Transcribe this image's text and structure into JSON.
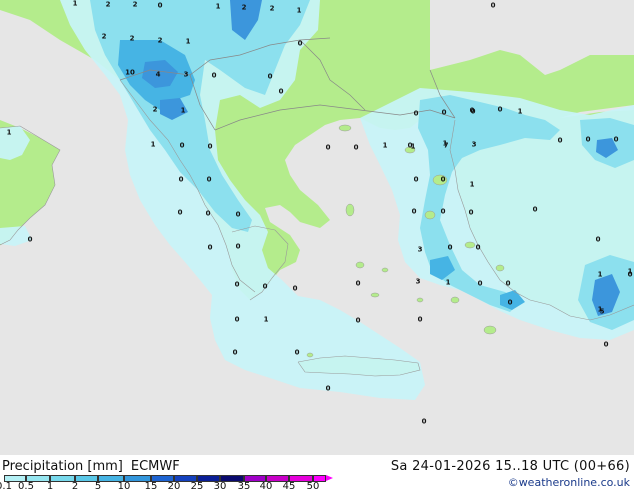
{
  "title": {
    "variable": "Precipitation [mm]",
    "model": "ECMWF",
    "valid_time": "Sa 24-01-2026 15..18 UTC (00+66)"
  },
  "credit": "©weatheronline.co.uk",
  "legend": {
    "ticks": [
      "0.1",
      "0.5",
      "1",
      "2",
      "5",
      "10",
      "15",
      "20",
      "25",
      "30",
      "35",
      "40",
      "45",
      "50"
    ],
    "colors": [
      "#b4f0f5",
      "#96e6f0",
      "#78d9ec",
      "#5ac8e8",
      "#46b4e4",
      "#3296dc",
      "#1e64d2",
      "#1441be",
      "#0a1e96",
      "#0a0a6e",
      "#a000c8",
      "#c800c8",
      "#e600dc",
      "#ff00ff"
    ]
  },
  "colors": {
    "sea": "#e6e6e6",
    "land": "#b4ec8c",
    "precip_light": "#c8f4f8",
    "precip_mid": "#8ce0ee",
    "precip_heavy": "#3c96dc",
    "borders": "#888888"
  },
  "values": [
    {
      "t": "1"
    },
    {
      "t": "2"
    },
    {
      "t": "2"
    },
    {
      "t": "0"
    },
    {
      "t": "1"
    },
    {
      "t": "2"
    },
    {
      "t": "2"
    },
    {
      "t": "1"
    },
    {
      "t": "0"
    },
    {
      "t": "2"
    },
    {
      "t": "2"
    },
    {
      "t": "2"
    },
    {
      "t": "1"
    },
    {
      "t": "0"
    },
    {
      "t": "10"
    },
    {
      "t": "4"
    },
    {
      "t": "3"
    },
    {
      "t": "0"
    },
    {
      "t": "0"
    },
    {
      "t": "0"
    },
    {
      "t": "1"
    },
    {
      "t": "2"
    },
    {
      "t": "1"
    },
    {
      "t": "1"
    },
    {
      "t": "0"
    },
    {
      "t": "0"
    },
    {
      "t": "0"
    },
    {
      "t": "0"
    },
    {
      "t": "1"
    },
    {
      "t": "1"
    },
    {
      "t": "1"
    },
    {
      "t": "0"
    },
    {
      "t": "0"
    },
    {
      "t": "1"
    },
    {
      "t": "0"
    },
    {
      "t": "0"
    },
    {
      "t": "0"
    },
    {
      "t": "0"
    },
    {
      "t": "0"
    },
    {
      "t": "0"
    },
    {
      "t": "0"
    },
    {
      "t": "0"
    },
    {
      "t": "0"
    },
    {
      "t": "0"
    },
    {
      "t": "0"
    },
    {
      "t": "0"
    },
    {
      "t": "0"
    },
    {
      "t": "1"
    },
    {
      "t": "0"
    },
    {
      "t": "0"
    },
    {
      "t": "0"
    },
    {
      "t": "0"
    },
    {
      "t": "0"
    },
    {
      "t": "0"
    },
    {
      "t": "0"
    },
    {
      "t": "0"
    },
    {
      "t": "0"
    },
    {
      "t": "3"
    },
    {
      "t": "0"
    },
    {
      "t": "0"
    },
    {
      "t": "1"
    },
    {
      "t": "0"
    },
    {
      "t": "7"
    },
    {
      "t": "3"
    },
    {
      "t": "0"
    },
    {
      "t": "0"
    },
    {
      "t": "0"
    },
    {
      "t": "0"
    },
    {
      "t": "3"
    },
    {
      "t": "1"
    },
    {
      "t": "0"
    },
    {
      "t": "0"
    },
    {
      "t": "0"
    },
    {
      "t": "1"
    },
    {
      "t": "0"
    },
    {
      "t": "0"
    },
    {
      "t": "0"
    },
    {
      "t": "1"
    },
    {
      "t": "1"
    },
    {
      "t": "5"
    },
    {
      "t": "0"
    },
    {
      "t": "0"
    },
    {
      "t": "0"
    },
    {
      "t": "0"
    },
    {
      "t": "0"
    }
  ]
}
